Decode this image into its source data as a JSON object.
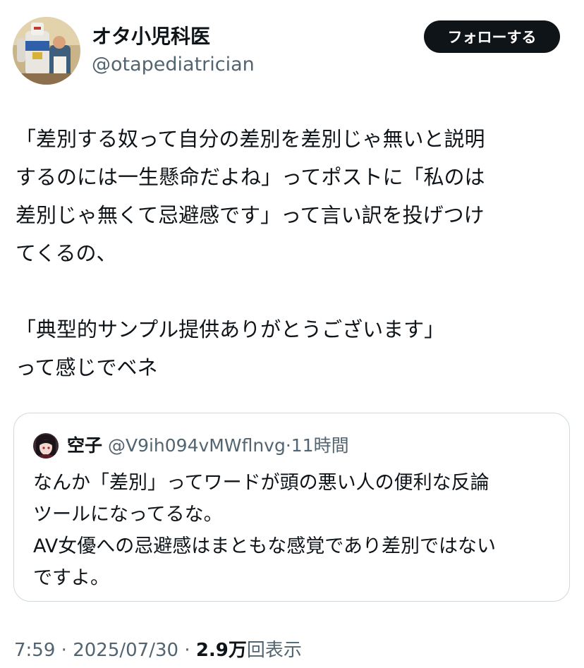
{
  "author": {
    "display_name": "オタ小児科医",
    "handle": "@otapediatrician"
  },
  "follow_button": {
    "label": "フォローする"
  },
  "tweet": {
    "lines": [
      "「差別する奴って自分の差別を差別じゃ無いと説明",
      "するのには一生懸命だよね」ってポストに「私のは",
      "差別じゃ無くて忌避感です」って言い訳を投げつけ",
      "てくるの、",
      "",
      "「典型的サンプル提供ありがとうございます」",
      "って感じでベネ"
    ]
  },
  "quote": {
    "display_name": "空子",
    "handle": "@V9ih094vMWflnvg",
    "separator": "·",
    "time": "11時間",
    "lines": [
      "なんか「差別」ってワードが頭の悪い人の便利な反論",
      "ツールになってるな。",
      "AV女優への忌避感はまともな感覚であり差別ではない",
      "ですよ。"
    ]
  },
  "meta": {
    "time": "7:59",
    "date": "2025/07/30",
    "separator": "·",
    "views_count": "2.9万",
    "views_label": "回表示"
  },
  "colors": {
    "text_primary": "#0f1419",
    "text_secondary": "#536471",
    "border": "#cfd9de",
    "button_bg": "#0f1419"
  },
  "icons": {
    "author_avatar": "robot-illustration-avatar",
    "quote_avatar": "anime-girl-avatar"
  }
}
